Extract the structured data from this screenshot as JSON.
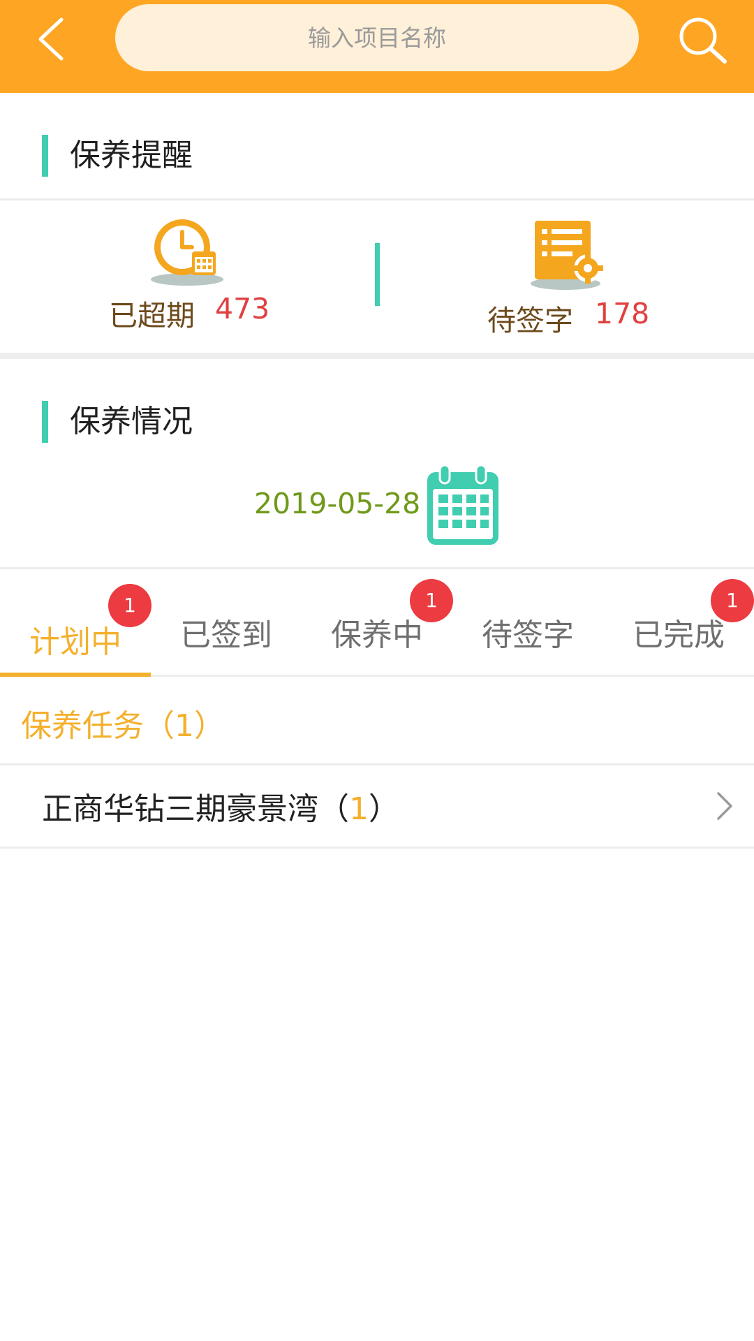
{
  "header": {
    "search_placeholder": "输入项目名称",
    "accent_color": "#fea623",
    "back_icon": "chevron-left-icon",
    "search_icon": "search-icon"
  },
  "reminder": {
    "title": "保养提醒",
    "overdue": {
      "label": "已超期",
      "value": "473",
      "icon": "clock-calendar-icon"
    },
    "pending_sign": {
      "label": "待签字",
      "value": "178",
      "icon": "document-gear-icon"
    }
  },
  "status": {
    "title": "保养情况",
    "date": "2019-05-28",
    "date_icon": "calendar-icon"
  },
  "tabs": [
    {
      "label": "计划中",
      "badge": "1",
      "active": true
    },
    {
      "label": "已签到",
      "badge": ""
    },
    {
      "label": "保养中",
      "badge": "1"
    },
    {
      "label": "待签字",
      "badge": ""
    },
    {
      "label": "已完成",
      "badge": "1"
    }
  ],
  "tasks": {
    "header": "保养任务（1）",
    "items": [
      {
        "name": "正商华钻三期豪景湾",
        "open": "（",
        "count": "1",
        "close": "）"
      }
    ]
  }
}
